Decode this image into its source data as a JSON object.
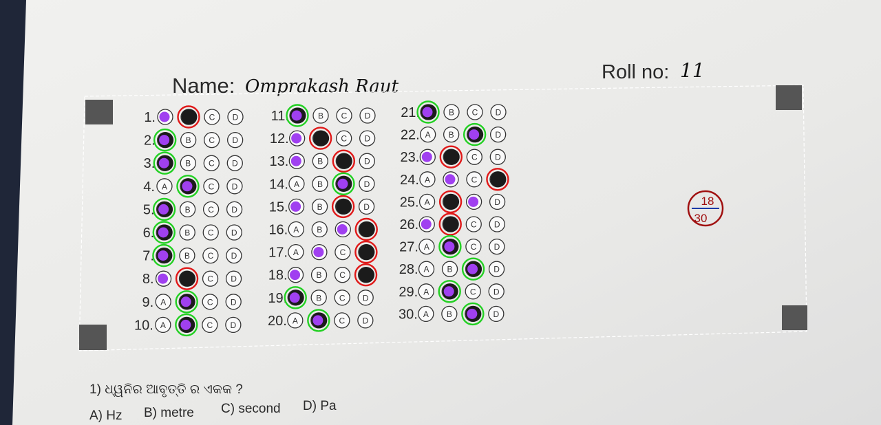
{
  "sheet": {
    "name_label": "Name:",
    "name_value": "Omprakash Raut",
    "roll_label": "Roll no:",
    "roll_value": "11",
    "score": {
      "obtained": "18",
      "total": "30"
    },
    "option_letters": [
      "A",
      "B",
      "C",
      "D"
    ],
    "questions": [
      {
        "label": "1.",
        "student": "B",
        "key": "A"
      },
      {
        "label": "2.",
        "student": "A",
        "key": "A"
      },
      {
        "label": "3.",
        "student": "A",
        "key": "A"
      },
      {
        "label": "4.",
        "student": "B",
        "key": "B"
      },
      {
        "label": "5.",
        "student": "A",
        "key": "A"
      },
      {
        "label": "6.",
        "student": "A",
        "key": "A"
      },
      {
        "label": "7.",
        "student": "A",
        "key": "A"
      },
      {
        "label": "8.",
        "student": "B",
        "key": "A"
      },
      {
        "label": "9.",
        "student": "B",
        "key": "B"
      },
      {
        "label": "10.",
        "student": "B",
        "key": "B"
      },
      {
        "label": "11.",
        "student": "A",
        "key": "A"
      },
      {
        "label": "12.",
        "student": "B",
        "key": "A"
      },
      {
        "label": "13.",
        "student": "C",
        "key": "A"
      },
      {
        "label": "14.",
        "student": "C",
        "key": "C"
      },
      {
        "label": "15.",
        "student": "C",
        "key": "A"
      },
      {
        "label": "16.",
        "student": "D",
        "key": "C"
      },
      {
        "label": "17.",
        "student": "D",
        "key": "B"
      },
      {
        "label": "18.",
        "student": "D",
        "key": "A"
      },
      {
        "label": "19.",
        "student": "A",
        "key": "A"
      },
      {
        "label": "20.",
        "student": "B",
        "key": "B"
      },
      {
        "label": "21.",
        "student": "A",
        "key": "A"
      },
      {
        "label": "22.",
        "student": "C",
        "key": "C"
      },
      {
        "label": "23.",
        "student": "B",
        "key": "A"
      },
      {
        "label": "24.",
        "student": "D",
        "key": "B"
      },
      {
        "label": "25.",
        "student": "B",
        "key": "C"
      },
      {
        "label": "26.",
        "student": "B",
        "key": "A"
      },
      {
        "label": "27.",
        "student": "B",
        "key": "B"
      },
      {
        "label": "28.",
        "student": "C",
        "key": "C"
      },
      {
        "label": "29.",
        "student": "B",
        "key": "B"
      },
      {
        "label": "30.",
        "student": "C",
        "key": "C"
      }
    ]
  },
  "question_text": {
    "prompt": "1) ଧ୍ୱନିର ଆବୃତ୍ତି ର ଏକକ ?",
    "options": [
      "A) Hz",
      "B) metre",
      "C) second",
      "D) Pa"
    ]
  },
  "colors": {
    "correct": "#22d022",
    "wrong": "#e01818",
    "key_fill": "#a040f0",
    "student_fill": "#1b1b1b",
    "score_red": "#a01010",
    "score_blue": "#1a3aa8"
  }
}
